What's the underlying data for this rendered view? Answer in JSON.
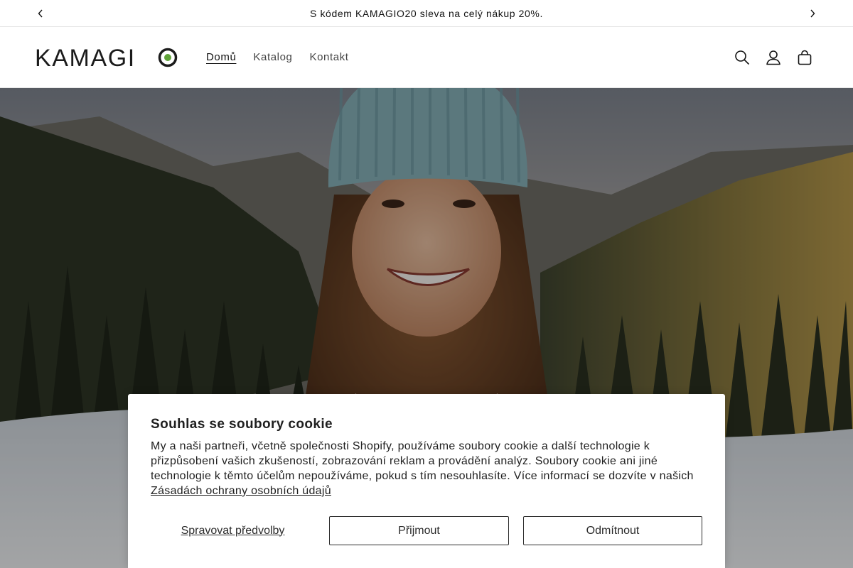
{
  "announcement": {
    "text": "S kódem KAMAGIO20 sleva na celý nákup 20%.",
    "prev_icon": "chevron-left-icon",
    "next_icon": "chevron-right-icon"
  },
  "header": {
    "logo_text": "KAMAGIO",
    "nav": [
      {
        "label": "Domů",
        "active": true
      },
      {
        "label": "Katalog",
        "active": false
      },
      {
        "label": "Kontakt",
        "active": false
      }
    ],
    "icons": [
      "search-icon",
      "account-icon",
      "cart-icon"
    ]
  },
  "hero": {
    "image": "woman-in-knit-beanie-winter-mountains"
  },
  "cookie_banner": {
    "title": "Souhlas se soubory cookie",
    "body": "My a naši partneři, včetně společnosti Shopify, používáme soubory cookie a další technologie k přizpůsobení vašich zkušeností, zobrazování reklam a provádění analýz. Soubory cookie ani jiné technologie k těmto účelům nepoužíváme, pokud s tím nesouhlasíte. Více informací se dozvíte v našich ",
    "policy_link": "Zásadách ochrany osobních údajů",
    "manage_label": "Spravovat předvolby",
    "accept_label": "Přijmout",
    "decline_label": "Odmítnout"
  },
  "colors": {
    "logo_accent": "#5fa338",
    "text": "#121212",
    "border": "#e6e6e6"
  }
}
